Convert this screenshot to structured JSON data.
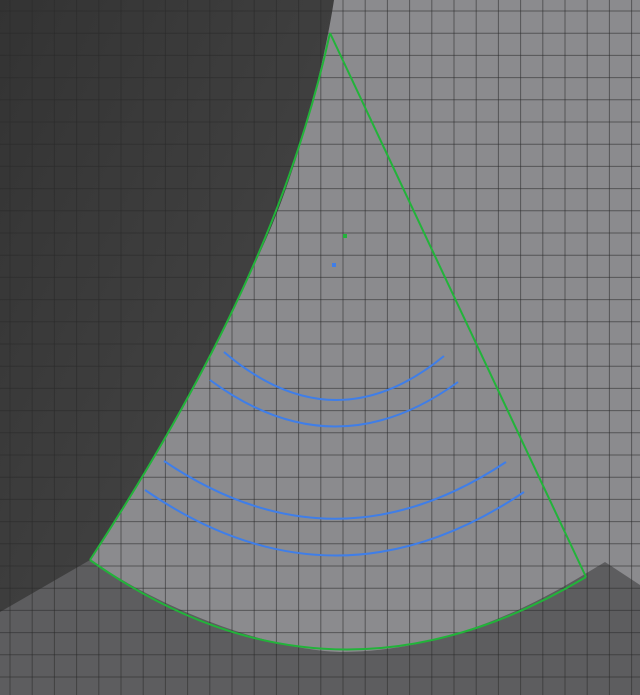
{
  "viewport": {
    "background_dark": "#393939",
    "background_light": "#8b8b8e",
    "background_mid": "#5d5d5f",
    "grid_color": "#2a2a2a"
  },
  "shape": {
    "outline_color": "#22b33a",
    "guide_color": "#3f7ee8",
    "pivot_color": "#22b33a",
    "center_color": "#3f7ee8"
  }
}
